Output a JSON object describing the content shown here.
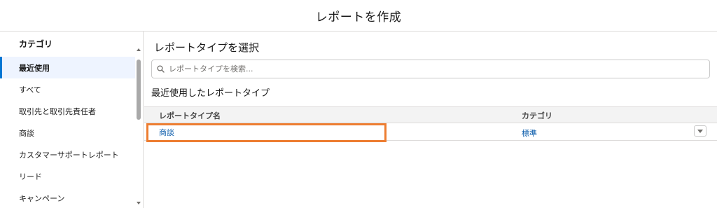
{
  "header": {
    "title": "レポートを作成"
  },
  "sidebar": {
    "heading": "カテゴリ",
    "items": [
      {
        "label": "最近使用",
        "active": true
      },
      {
        "label": "すべて"
      },
      {
        "label": "取引先と取引先責任者"
      },
      {
        "label": "商談"
      },
      {
        "label": "カスタマーサポートレポート"
      },
      {
        "label": "リード"
      },
      {
        "label": "キャンペーン"
      }
    ]
  },
  "main": {
    "title": "レポートタイプを選択",
    "search": {
      "placeholder": "レポートタイプを検索..."
    },
    "section_title": "最近使用したレポートタイプ",
    "table": {
      "columns": [
        "レポートタイプ名",
        "カテゴリ"
      ],
      "rows": [
        {
          "name": "商談",
          "category": "標準"
        }
      ]
    }
  },
  "colors": {
    "accent": "#0176d3",
    "link": "#0b5cab",
    "highlight": "#ed7d31"
  },
  "icons": {
    "search": "search-icon",
    "row_menu": "chevron-down-icon"
  }
}
